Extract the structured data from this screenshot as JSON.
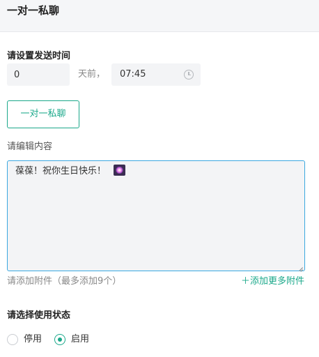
{
  "header": {
    "title": "一对一私聊"
  },
  "schedule": {
    "label": "请设置发送时间",
    "days_value": "0",
    "days_suffix": "天前，",
    "time_value": "07:45",
    "time_icon": "clock-icon"
  },
  "chat_type_button": {
    "label": "一对一私聊"
  },
  "content": {
    "label": "请编辑内容",
    "message": "葆葆！祝你生日快乐！",
    "emoji_icon": "sparkle-icon"
  },
  "attachments": {
    "hint": "请添加附件（最多添加9个）",
    "add_more": "＋添加更多附件"
  },
  "status": {
    "label": "请选择使用状态",
    "options": [
      {
        "label": "停用",
        "selected": false
      },
      {
        "label": "启用",
        "selected": true
      }
    ]
  },
  "colors": {
    "accent": "#1aa88a",
    "focus_border": "#3aa8e0",
    "header_bg": "#f5f6f8"
  }
}
